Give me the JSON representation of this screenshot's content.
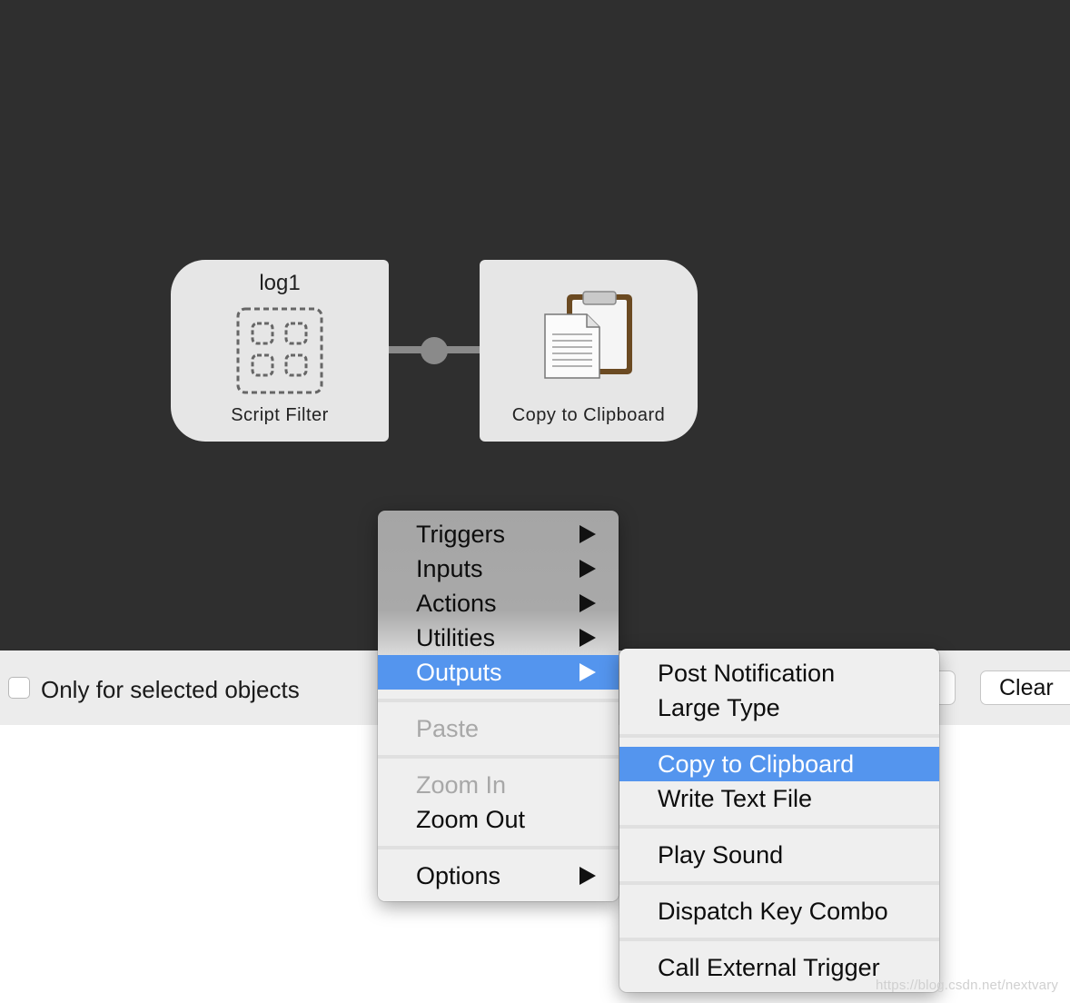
{
  "nodes": {
    "script_filter": {
      "title": "log1",
      "label": "Script Filter"
    },
    "copy_clipboard": {
      "label": "Copy to Clipboard"
    }
  },
  "panel": {
    "checkbox_label": "Only for selected objects",
    "clear_label": "Clear"
  },
  "context_menu": {
    "items": [
      {
        "label": "Triggers",
        "submenu": true
      },
      {
        "label": "Inputs",
        "submenu": true
      },
      {
        "label": "Actions",
        "submenu": true
      },
      {
        "label": "Utilities",
        "submenu": true
      },
      {
        "label": "Outputs",
        "submenu": true,
        "highlighted": true
      },
      {
        "label": "Paste",
        "disabled": true
      },
      {
        "label": "Zoom In",
        "disabled": true
      },
      {
        "label": "Zoom Out"
      },
      {
        "label": "Options",
        "submenu": true
      }
    ]
  },
  "outputs_submenu": {
    "items": [
      {
        "label": "Post Notification"
      },
      {
        "label": "Large Type"
      },
      {
        "label": "Copy to Clipboard",
        "highlighted": true
      },
      {
        "label": "Write Text File"
      },
      {
        "label": "Play Sound"
      },
      {
        "label": "Dispatch Key Combo"
      },
      {
        "label": "Call External Trigger"
      }
    ]
  },
  "colors": {
    "canvas": "#2f2f2f",
    "node": "#e6e6e6",
    "highlight": "#5495ee",
    "connector": "#8a8a8a"
  },
  "watermark": "https://blog.csdn.net/nextvary"
}
